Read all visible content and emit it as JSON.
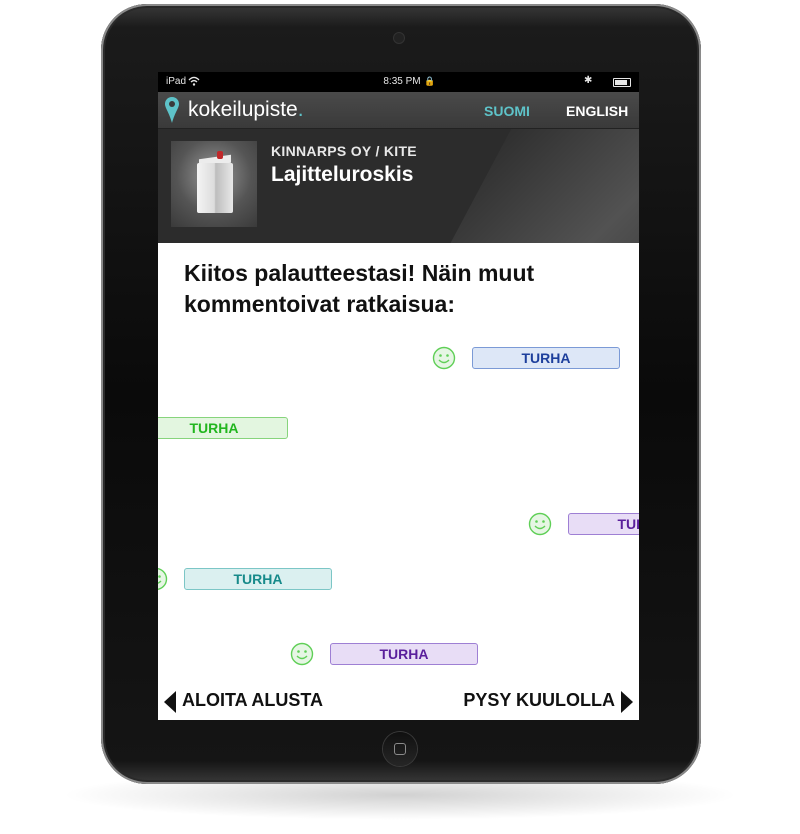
{
  "status_bar": {
    "carrier": "iPad",
    "time": "8:35 PM"
  },
  "brand": {
    "name": "kokeilupiste",
    "dot": ".",
    "accent_color": "#5ec3c9"
  },
  "languages": [
    {
      "label": "SUOMI",
      "active": true
    },
    {
      "label": "ENGLISH",
      "active": false
    }
  ],
  "product": {
    "company": "KINNARPS OY / KITE",
    "name": "Lajitteluroskis"
  },
  "thanks_message": "Kiitos palautteestasi! Näin muut kommentoivat ratkaisua:",
  "comments": [
    {
      "text": "TURHA",
      "color": "blue",
      "smiley": true
    },
    {
      "text": "TURHA",
      "color": "green",
      "smiley": false
    },
    {
      "text": "TURHA",
      "color": "purple",
      "smiley": true
    },
    {
      "text": "TURHA",
      "color": "teal",
      "smiley": true
    },
    {
      "text": "TURHA",
      "color": "purple",
      "smiley": true
    }
  ],
  "navigation": {
    "back_label": "ALOITA ALUSTA",
    "forward_label": "PYSY KUULOLLA"
  },
  "icons": [
    "wifi-icon",
    "lock-icon",
    "bluetooth-icon",
    "battery-icon",
    "map-pin-icon",
    "smiley-icon",
    "arrow-left-icon",
    "arrow-right-icon"
  ]
}
